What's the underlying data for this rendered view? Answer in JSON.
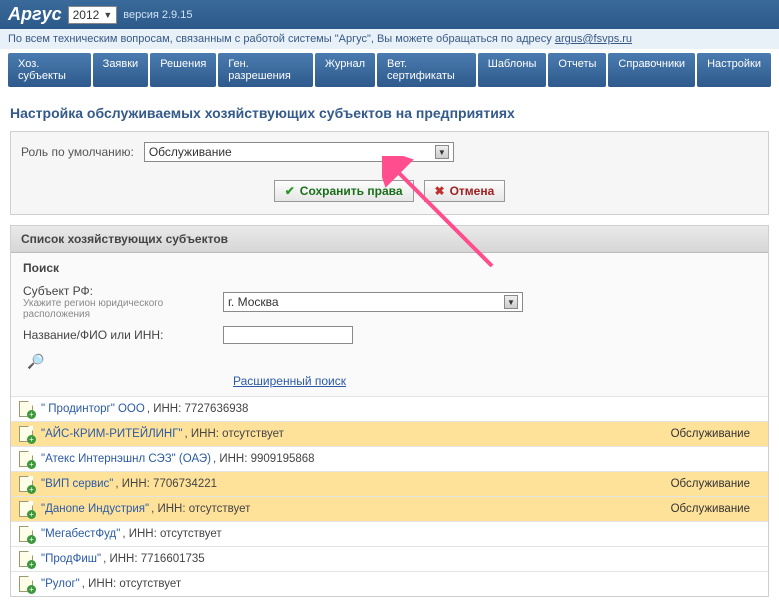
{
  "header": {
    "app_name": "Аргус",
    "year": "2012",
    "version": "версия 2.9.15"
  },
  "subheader": {
    "text": "По всем техническим вопросам, связанным с работой системы \"Аргус\", Вы можете обращаться по адресу ",
    "email": "argus@fsvps.ru"
  },
  "nav": [
    "Хоз. субъекты",
    "Заявки",
    "Решения",
    "Ген. разрешения",
    "Журнал",
    "Вет. сертификаты",
    "Шаблоны",
    "Отчеты",
    "Справочники",
    "Настройки"
  ],
  "page_title": "Настройка обслуживаемых хозяйствующих субъектов на предприятиях",
  "role_block": {
    "label": "Роль по умолчанию:",
    "value": "Обслуживание",
    "save_label": "Сохранить права",
    "cancel_label": "Отмена"
  },
  "list_section": {
    "title": "Список хозяйствующих субъектов",
    "search_title": "Поиск",
    "region_label": "Субъект РФ:",
    "region_hint": "Укажите регион юридического расположения",
    "region_value": "г. Москва",
    "name_label": "Название/ФИО или ИНН:",
    "adv_search": "Расширенный поиск"
  },
  "entities": [
    {
      "name": "\" Продинторг\" ООО",
      "inn": "7727636938",
      "role": "",
      "hl": false
    },
    {
      "name": "\"АЙС-КРИМ-РИТЕЙЛИНГ\"",
      "inn": "отсутствует",
      "role": "Обслуживание",
      "hl": true
    },
    {
      "name": "\"Атекс Интернэшнл СЭЗ\" (ОАЭ)",
      "inn": "9909195868",
      "role": "",
      "hl": false
    },
    {
      "name": "\"ВИП сервис\"",
      "inn": "7706734221",
      "role": "Обслуживание",
      "hl": true
    },
    {
      "name": "\"Данone Индустрия\"",
      "inn": "отсутствует",
      "role": "Обслуживание",
      "hl": true
    },
    {
      "name": "\"МегабестФуд\"",
      "inn": "отсутствует",
      "role": "",
      "hl": false
    },
    {
      "name": "\"ПродФиш\"",
      "inn": "7716601735",
      "role": "",
      "hl": false
    },
    {
      "name": "\"Рулог\"",
      "inn": "отсутствует",
      "role": "",
      "hl": false
    }
  ]
}
